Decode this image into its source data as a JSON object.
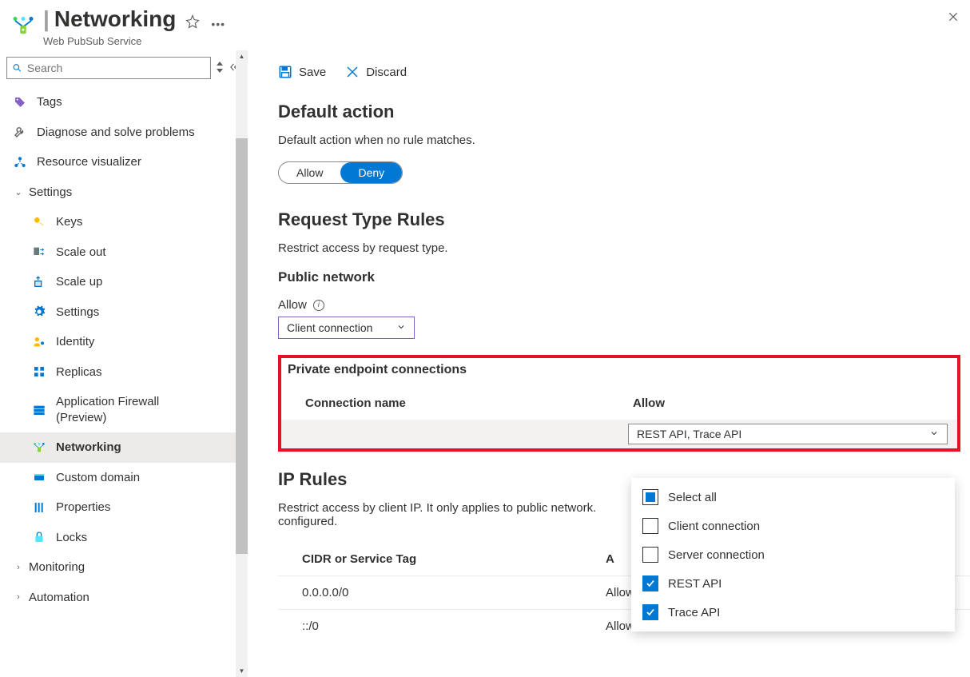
{
  "header": {
    "page_title": "Networking",
    "service_name": "Web PubSub Service"
  },
  "search": {
    "placeholder": "Search"
  },
  "nav": {
    "tags": "Tags",
    "diagnose": "Diagnose and solve problems",
    "resource_vis": "Resource visualizer",
    "settings": "Settings",
    "keys": "Keys",
    "scale_out": "Scale out",
    "scale_up": "Scale up",
    "settings_sub": "Settings",
    "identity": "Identity",
    "replicas": "Replicas",
    "app_firewall": "Application Firewall (Preview)",
    "networking": "Networking",
    "custom_domain": "Custom domain",
    "properties": "Properties",
    "locks": "Locks",
    "monitoring": "Monitoring",
    "automation": "Automation"
  },
  "toolbar": {
    "save": "Save",
    "discard": "Discard"
  },
  "main": {
    "default_action_h": "Default action",
    "default_action_desc": "Default action when no rule matches.",
    "allow": "Allow",
    "deny": "Deny",
    "request_type_h": "Request Type Rules",
    "request_type_desc": "Restrict access by request type.",
    "public_network_h": "Public network",
    "allow_label": "Allow",
    "client_connection": "Client connection",
    "pvt_h": "Private endpoint connections",
    "conn_name": "Connection name",
    "allow_col": "Allow",
    "allow_val": "REST API, Trace API",
    "dd": {
      "select_all": "Select all",
      "client": "Client connection",
      "server": "Server connection",
      "rest": "REST API",
      "trace": "Trace API"
    },
    "ip_h": "IP Rules",
    "ip_desc_a": "Restrict access by client IP. It only applies to public network.",
    "ip_desc_b": "configured.",
    "cidr_col": "CIDR or Service Tag",
    "act_col_short": "A",
    "rule1_cidr": "0.0.0.0/0",
    "rule1_act": "Allow",
    "rule2_cidr": "::/0",
    "rule2_act": "Allow"
  }
}
